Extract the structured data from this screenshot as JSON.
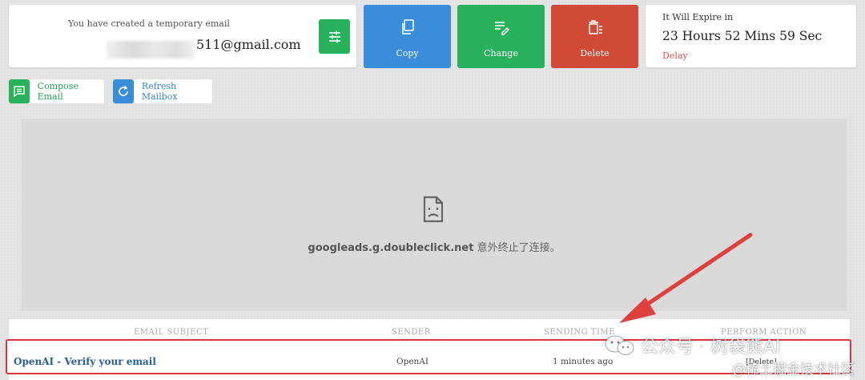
{
  "email_card": {
    "caption": "You have created a temporary email",
    "address_suffix": "511@gmail.com"
  },
  "actions": {
    "copy_label": "Copy",
    "change_label": "Change",
    "delete_label": "Delete"
  },
  "expire": {
    "caption": "It Will Expire in",
    "remaining": "23 Hours 52 Mins 59 Sec",
    "delay_label": "Delay"
  },
  "toolbar": {
    "compose_label": "Compose Email",
    "refresh_label": "Refresh Mailbox"
  },
  "ad_frame": {
    "domain": "googleads.g.doubleclick.net",
    "message": " 意外终止了连接。"
  },
  "table": {
    "headers": [
      "EMAIL SUBJECT",
      "SENDER",
      "SENDING TIME",
      "PERFORM ACTION"
    ],
    "rows": [
      {
        "subject": "OpenAI - Verify your email",
        "sender": "OpenAI",
        "time": "1 minutes ago",
        "action": "[Delete]"
      }
    ]
  },
  "watermarks": {
    "account": "公众号 · 树袋熊AI",
    "site": "@稀土掘金技术社区"
  },
  "colors": {
    "green": "#27b25b",
    "blue": "#3a8dd8",
    "red": "#d04a35",
    "highlight": "#d9363e"
  },
  "icons": [
    "settings-sliders-icon",
    "copy-icon",
    "edit-icon",
    "trash-icon",
    "compose-icon",
    "refresh-icon",
    "broken-page-icon",
    "wechat-icon"
  ]
}
